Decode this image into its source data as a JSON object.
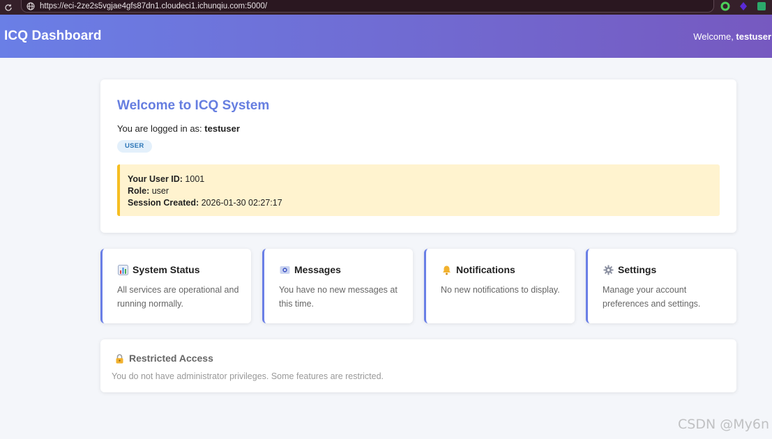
{
  "browser": {
    "url": "https://eci-2ze2s5vgjae4gfs87dn1.cloudeci1.ichunqiu.com:5000/"
  },
  "header": {
    "title": "ICQ Dashboard",
    "welcome_prefix": "Welcome, ",
    "username": "testuser"
  },
  "welcome_card": {
    "title": "Welcome to ICQ System",
    "logged_prefix": "You are logged in as: ",
    "username": "testuser",
    "role_badge": "USER",
    "info": {
      "user_id_label": "Your User ID:",
      "user_id_value": " 1001",
      "role_label": "Role:",
      "role_value": " user",
      "session_label": "Session Created:",
      "session_value": " 2026-01-30 02:27:17"
    }
  },
  "features": [
    {
      "icon": "bar-chart-icon",
      "title": "System Status",
      "description": "All services are operational and running normally."
    },
    {
      "icon": "message-icon",
      "title": "Messages",
      "description": "You have no new messages at this time."
    },
    {
      "icon": "bell-icon",
      "title": "Notifications",
      "description": "No new notifications to display."
    },
    {
      "icon": "gear-icon",
      "title": "Settings",
      "description": "Manage your account preferences and settings."
    }
  ],
  "restricted": {
    "icon": "lock-icon",
    "title": "Restricted Access",
    "description": "You do not have administrator privileges. Some features are restricted."
  },
  "watermark": "CSDN @My6n",
  "colors": {
    "header_start": "#6a7fe6",
    "header_end": "#7659c0",
    "accent": "#667ee0",
    "info_bg": "#fff3cf",
    "info_border": "#f6be22"
  }
}
